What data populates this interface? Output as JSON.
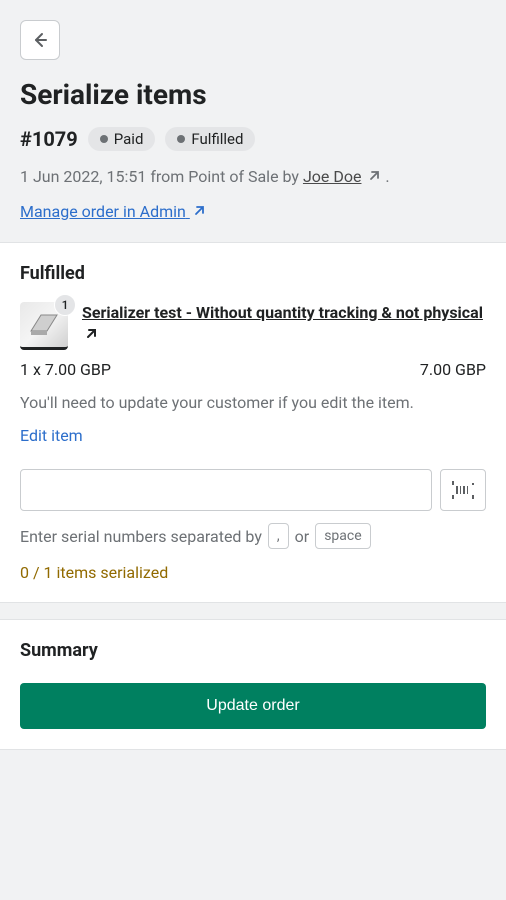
{
  "header": {
    "title": "Serialize items",
    "order_number": "#1079",
    "badges": {
      "paid": "Paid",
      "fulfilled": "Fulfilled"
    },
    "meta_date": "1 Jun 2022, 15:51 ",
    "meta_from": "from Point of Sale by ",
    "author": "Joe Doe",
    "meta_period": " .",
    "manage_link": "Manage order in Admin"
  },
  "fulfilled": {
    "section_title": "Fulfilled",
    "item": {
      "qty_badge": "1",
      "name": "Serializer test - Without quantity tracking & not physical",
      "qty_price": "1 x 7.00 GBP",
      "line_total": "7.00 GBP"
    },
    "helper": "You'll need to update your customer if you edit the item.",
    "edit_link": "Edit item",
    "serial_hint_prefix": "Enter serial numbers separated by",
    "kbd_comma": ",",
    "hint_or": "or",
    "kbd_space": "space",
    "serialized_count": "0 / 1 items serialized"
  },
  "summary": {
    "title": "Summary",
    "update_button": "Update order"
  }
}
